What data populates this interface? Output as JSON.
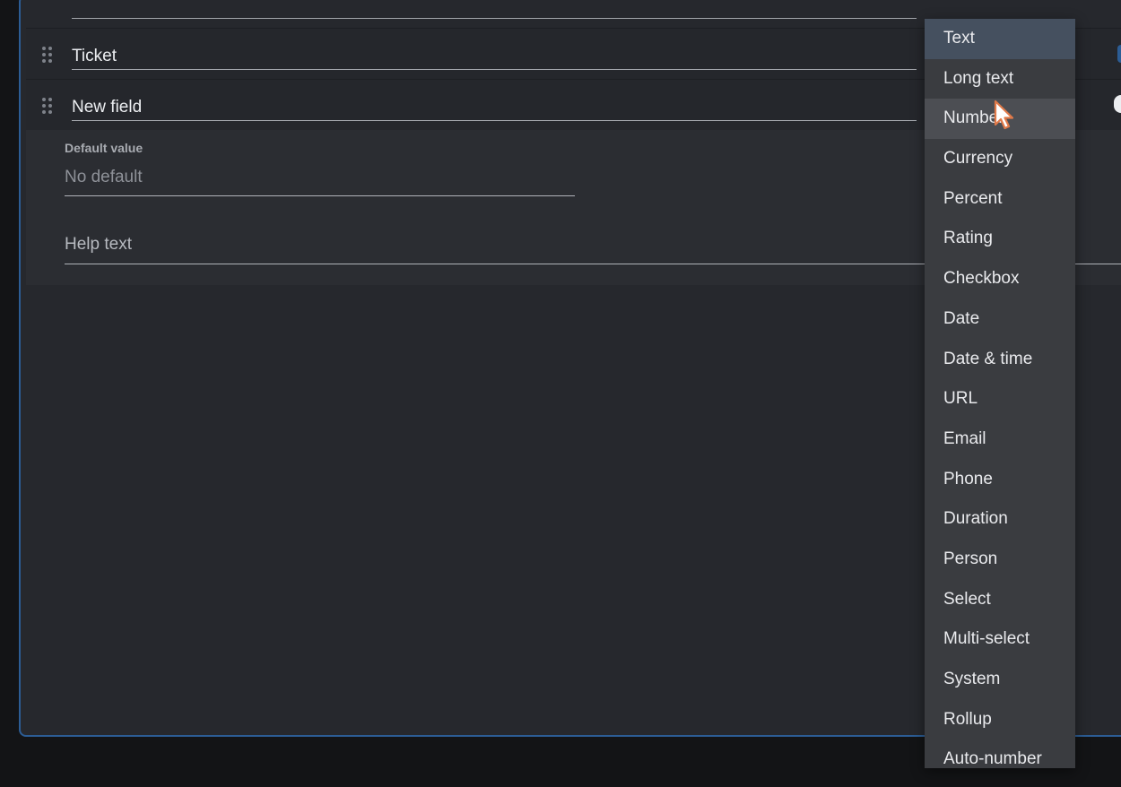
{
  "fields": [
    {
      "name": "Ticket"
    },
    {
      "name": "New field"
    }
  ],
  "details": {
    "default_label": "Default value",
    "default_placeholder": "No default",
    "help_placeholder": "Help text"
  },
  "type_menu": {
    "selected": "Text",
    "hovered": "Number",
    "options": [
      "Text",
      "Long text",
      "Number",
      "Currency",
      "Percent",
      "Rating",
      "Checkbox",
      "Date",
      "Date & time",
      "URL",
      "Email",
      "Phone",
      "Duration",
      "Person",
      "Select",
      "Multi-select",
      "System",
      "Rollup",
      "Auto-number"
    ]
  },
  "colors": {
    "accent_border": "#2c5d95",
    "selected_item": "#45505f",
    "hover_item": "#4c4e53",
    "cursor": "#e07a4a"
  },
  "icons": {
    "drag_handle": "drag-handle-icon",
    "cursor": "mouse-pointer-icon"
  }
}
